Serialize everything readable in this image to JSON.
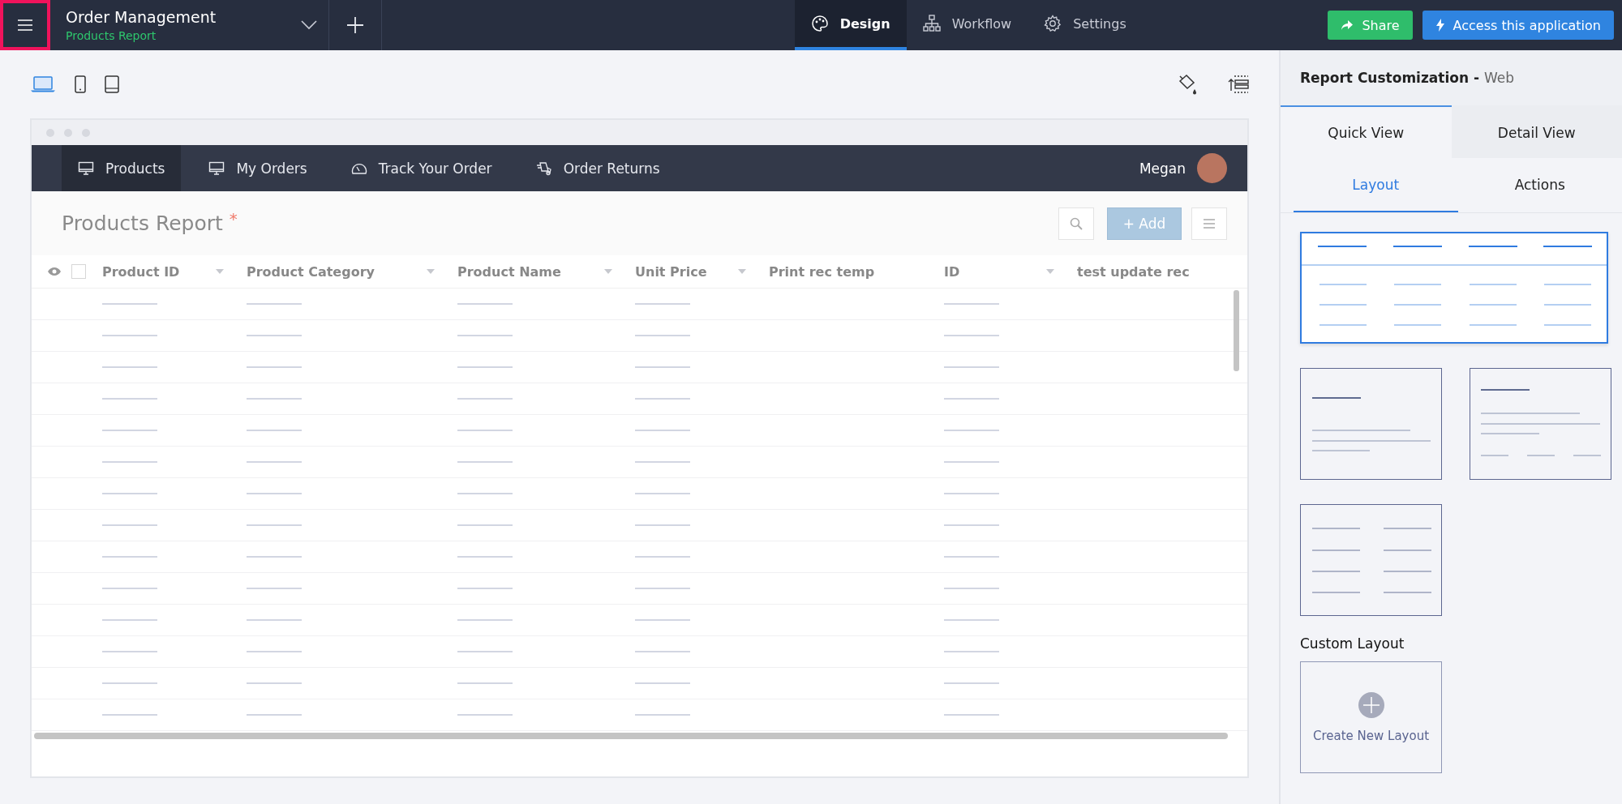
{
  "top_bar": {
    "menu_button": {
      "highlighted": true
    },
    "app_title": "Order Management",
    "app_subtitle": "Products Report",
    "tabs": [
      {
        "label": "Design",
        "selected": true
      },
      {
        "label": "Workflow",
        "selected": false
      },
      {
        "label": "Settings",
        "selected": false
      }
    ],
    "buttons": [
      {
        "label": "Share",
        "kind": "share"
      },
      {
        "label": "Access this application",
        "kind": "access"
      }
    ]
  },
  "device_toggles": [
    {
      "selected": true
    },
    {
      "selected": false
    },
    {
      "selected": false
    }
  ],
  "preview": {
    "nav_items": [
      {
        "label": "Products",
        "selected": true
      },
      {
        "label": "My Orders",
        "selected": false
      },
      {
        "label": "Track Your Order",
        "selected": false
      },
      {
        "label": "Order Returns",
        "selected": false
      }
    ],
    "select_all": {
      "checked": false
    },
    "user_name": "Megan",
    "report_title": "Products Report",
    "required_mark": "*",
    "add_button": "+ Add",
    "columns": [
      {
        "label": "Product ID",
        "sort_menu": true
      },
      {
        "label": "Product Category",
        "sort_menu": true
      },
      {
        "label": "Product Name",
        "sort_menu": true
      },
      {
        "label": "Unit Price",
        "sort_menu": true
      },
      {
        "label": "Print rec temp",
        "sort_menu": false
      },
      {
        "label": "ID",
        "sort_menu": true
      },
      {
        "label": "test update rec",
        "sort_menu": false
      }
    ]
  },
  "side_panel": {
    "title": "Report Customization -",
    "title_context": "Web",
    "view_tabs": [
      {
        "label": "Quick View",
        "selected": true
      },
      {
        "label": "Detail View",
        "selected": false
      }
    ],
    "sub_tabs": [
      {
        "label": "Layout",
        "selected": true
      },
      {
        "label": "Actions",
        "selected": false
      }
    ],
    "layouts": [
      {
        "kind": "table",
        "selected": true
      },
      {
        "kind": "card",
        "selected": false
      },
      {
        "kind": "detail",
        "selected": false
      },
      {
        "kind": "columns",
        "selected": false
      }
    ],
    "custom_heading": "Custom Layout",
    "create_label": "Create New Layout"
  }
}
